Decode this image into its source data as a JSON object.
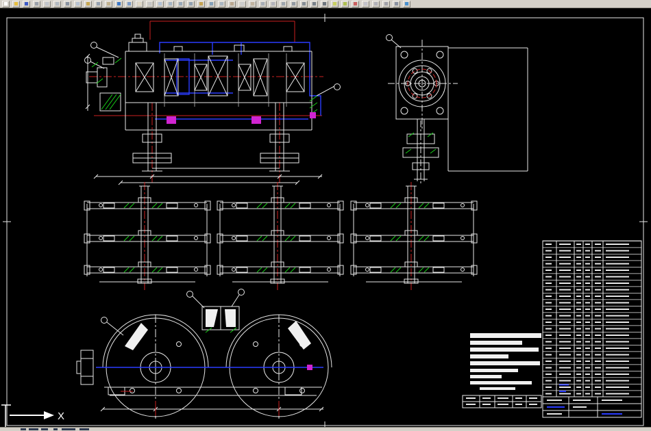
{
  "window": {
    "toolbar_background": "#d4d0c8",
    "canvas_background": "#000000"
  },
  "toolbar": {
    "icons": [
      {
        "name": "new-file-icon",
        "style": "background:#ffffff"
      },
      {
        "name": "open-folder-icon",
        "style": "background:#e8c040"
      },
      {
        "name": "save-icon",
        "style": "background:#3c5ac8"
      },
      {
        "name": "plot-icon",
        "style": "background:#9aa0aa"
      },
      {
        "name": "plot-preview-icon",
        "style": "background:#c2c6cc"
      },
      {
        "name": "publish-icon",
        "style": "background:#b2bac2"
      },
      {
        "name": "cut-icon",
        "style": "background:#8a94a2"
      },
      {
        "name": "copy-icon",
        "style": "background:#b6c2d2"
      },
      {
        "name": "paste-icon",
        "style": "background:#c8a850"
      },
      {
        "name": "match-properties-icon",
        "style": "background:#96a2b2"
      },
      {
        "name": "block-editor-icon",
        "style": "background:#c2b28e"
      },
      {
        "name": "undo-icon",
        "style": "background:#3c78c8"
      },
      {
        "name": "redo-icon",
        "style": "background:#7c9cc8"
      },
      {
        "name": "pan-icon",
        "style": "background:#e0d8c4"
      },
      {
        "name": "zoom-realtime-icon",
        "style": "background:#c6c6c6"
      },
      {
        "name": "zoom-window-icon",
        "style": "background:#b2c2d6"
      },
      {
        "name": "zoom-previous-icon",
        "style": "background:#a6b6c6"
      },
      {
        "name": "zoom-scale-icon",
        "style": "background:#9aaaba"
      },
      {
        "name": "properties-icon",
        "style": "background:#92a2b2"
      },
      {
        "name": "designcenter-icon",
        "style": "background:#c6a454"
      },
      {
        "name": "toolpalettes-icon",
        "style": "background:#86a2ba"
      },
      {
        "name": "sheetset-icon",
        "style": "background:#aab6c2"
      },
      {
        "name": "markup-icon",
        "style": "background:#baa890"
      },
      {
        "name": "calculator-icon",
        "style": "background:#cccccc"
      },
      {
        "name": "osnap-icon",
        "style": "background:#c2b4a0"
      },
      {
        "name": "grid-icon",
        "style": "background:#a8aeb6"
      },
      {
        "name": "ortho-icon",
        "style": "background:#b4b4bc"
      },
      {
        "name": "polar-icon",
        "style": "background:#9ea6ae"
      },
      {
        "name": "otrack-icon",
        "style": "background:#929aa2"
      },
      {
        "name": "dyn-icon",
        "style": "background:#868e96"
      },
      {
        "name": "lwt-icon",
        "style": "background:#7a828a"
      },
      {
        "name": "model-icon",
        "style": "background:#6e767e"
      },
      {
        "name": "layers-icon",
        "style": "background:#c8d060"
      },
      {
        "name": "layer-states-icon",
        "style": "background:#aec050"
      },
      {
        "name": "color-control-icon",
        "style": "background:#cc6060"
      },
      {
        "name": "linetype-icon",
        "style": "background:#c2c2ca"
      },
      {
        "name": "lineweight-icon",
        "style": "background:#b2b2ba"
      },
      {
        "name": "plotstyle-icon",
        "style": "background:#a2a2aa"
      },
      {
        "name": "find-icon",
        "style": "background:#8a92a2"
      },
      {
        "name": "help-icon",
        "style": "background:#4890d0"
      }
    ]
  },
  "canvas": {
    "ucs_x_label": "X"
  },
  "drawing": {
    "line_colors": {
      "primary": "#e8e8e8",
      "blue": "#2a3cff",
      "red": "#cc2020",
      "green": "#18d018",
      "magenta": "#d024d0"
    },
    "parts_list": {
      "rows": 24,
      "columns": 6
    }
  }
}
